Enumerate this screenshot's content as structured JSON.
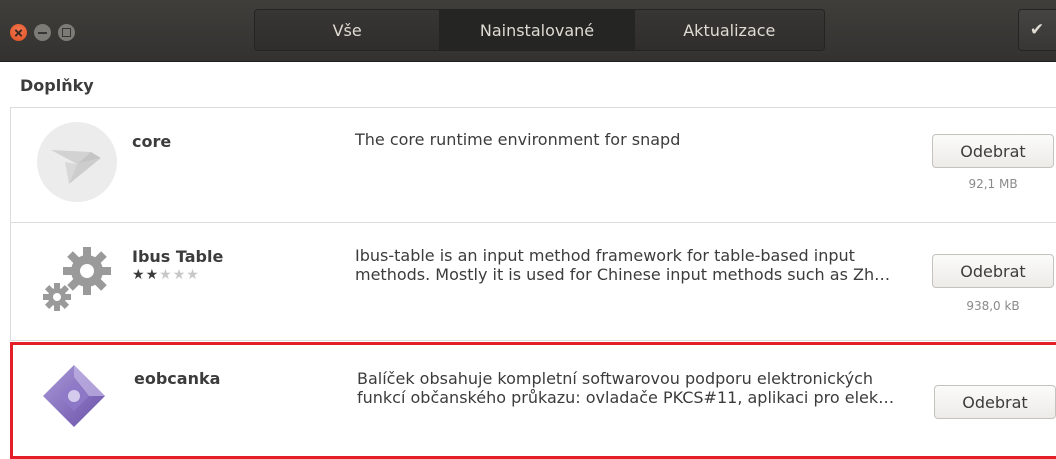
{
  "header": {
    "tabs": [
      {
        "label": "Vše",
        "active": false
      },
      {
        "label": "Nainstalované",
        "active": true
      },
      {
        "label": "Aktualizace",
        "active": false
      }
    ],
    "check_icon": "✔"
  },
  "section": {
    "title": "Doplňky"
  },
  "apps": [
    {
      "name": "core",
      "description": "The core runtime environment for snapd",
      "button": "Odebrat",
      "size": "92,1 MB",
      "icon": "snap-core-icon"
    },
    {
      "name": "Ibus Table",
      "description_line1": "Ibus-table is an input method framework for table-based input",
      "description_line2": "methods.  Mostly it is used for Chinese input methods such as Zh…",
      "button": "Odebrat",
      "size": "938,0 kB",
      "rating": 2,
      "rating_max": 5,
      "icon": "gears-icon"
    },
    {
      "name": "eobcanka",
      "description_line1": "Balíček obsahuje kompletní softwarovou podporu elektronických",
      "description_line2": "funkcí občanského průkazu: ovladače PKCS#11, aplikaci pro elek…",
      "button": "Odebrat",
      "icon": "eobcanka-icon"
    }
  ],
  "colors": {
    "highlight": "#e41e26",
    "header": "#3a3936"
  }
}
